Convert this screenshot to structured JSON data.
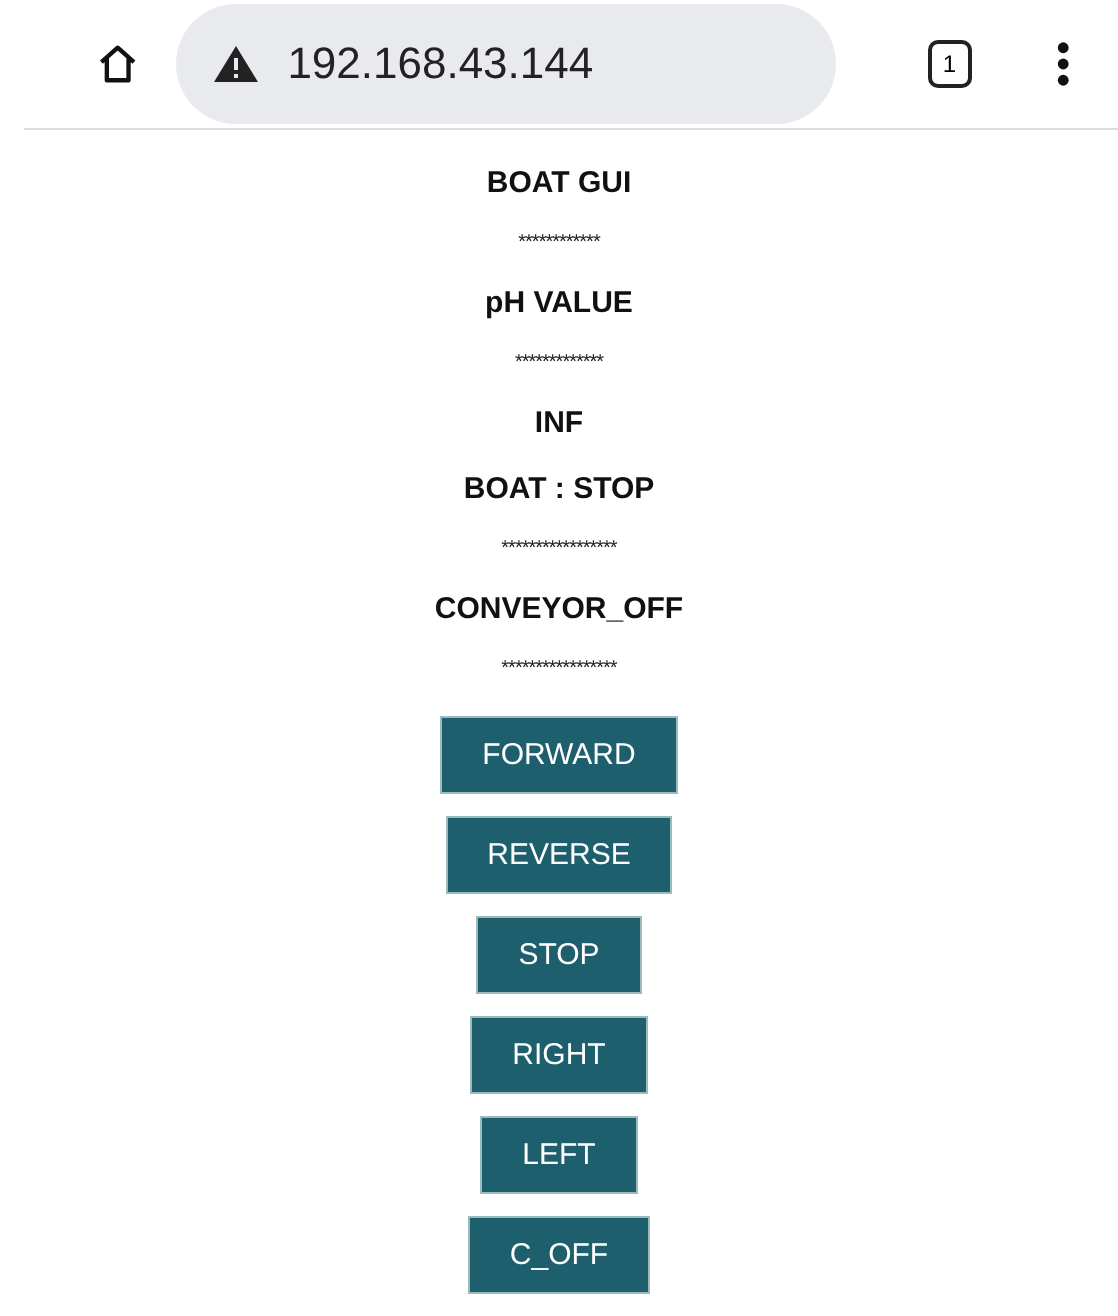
{
  "browser": {
    "address": "192.168.43.144",
    "tab_count": "1"
  },
  "lines": [
    {
      "kind": "heading",
      "text": "BOAT GUI"
    },
    {
      "kind": "stars",
      "text": "************"
    },
    {
      "kind": "heading",
      "text": "pH VALUE"
    },
    {
      "kind": "stars",
      "text": "*************"
    },
    {
      "kind": "heading",
      "text": "INF"
    },
    {
      "kind": "heading",
      "text": "BOAT : STOP"
    },
    {
      "kind": "stars",
      "text": "*****************"
    },
    {
      "kind": "heading",
      "text": "CONVEYOR_OFF"
    },
    {
      "kind": "stars",
      "text": "*****************"
    }
  ],
  "buttons": [
    "FORWARD",
    "REVERSE",
    "STOP",
    "RIGHT",
    "LEFT",
    "C_OFF"
  ]
}
